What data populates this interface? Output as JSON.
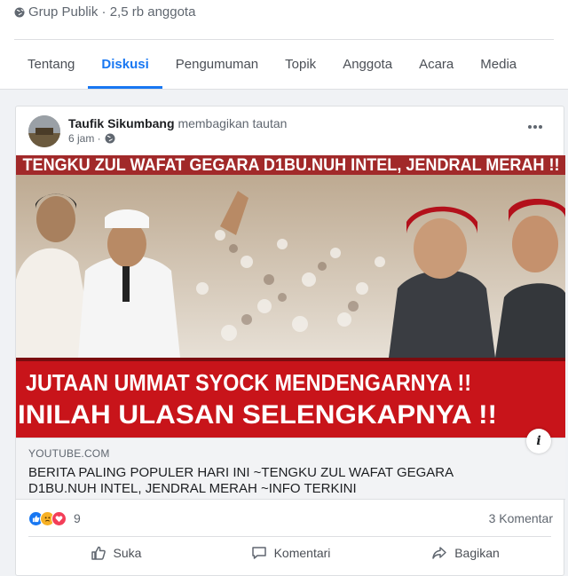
{
  "group": {
    "meta": "Grup Publik · 2,5 rb anggota"
  },
  "tabs": [
    {
      "label": "Tentang"
    },
    {
      "label": "Diskusi"
    },
    {
      "label": "Pengumuman"
    },
    {
      "label": "Topik"
    },
    {
      "label": "Anggota"
    },
    {
      "label": "Acara"
    },
    {
      "label": "Media"
    }
  ],
  "post": {
    "author": "Taufik Sikumbang",
    "action": "membagikan tautan",
    "time": "6 jam ·",
    "thumb": {
      "headline": "TENGKU ZUL WAFAT GEGARA D1BU.NUH INTEL, JENDRAL MERAH !!",
      "line1": "JUTAAN UMMAT SYOCK MENDENGARNYA !!",
      "line2": "INILAH ULASAN SELENGKAPNYA !!"
    },
    "link": {
      "domain": "YOUTUBE.COM",
      "title": "BERITA PALING POPULER HARI INI ~TENGKU ZUL WAFAT GEGARA D1BU.NUH INTEL, JENDRAL MERAH ~INFO TERKINI"
    },
    "reaction_count": "9",
    "comment_count": "3 Komentar",
    "actions": {
      "like": "Suka",
      "comment": "Komentari",
      "share": "Bagikan"
    },
    "info_button": "i"
  },
  "colors": {
    "accent": "#1877f2",
    "headline_red": "#c8141a"
  }
}
